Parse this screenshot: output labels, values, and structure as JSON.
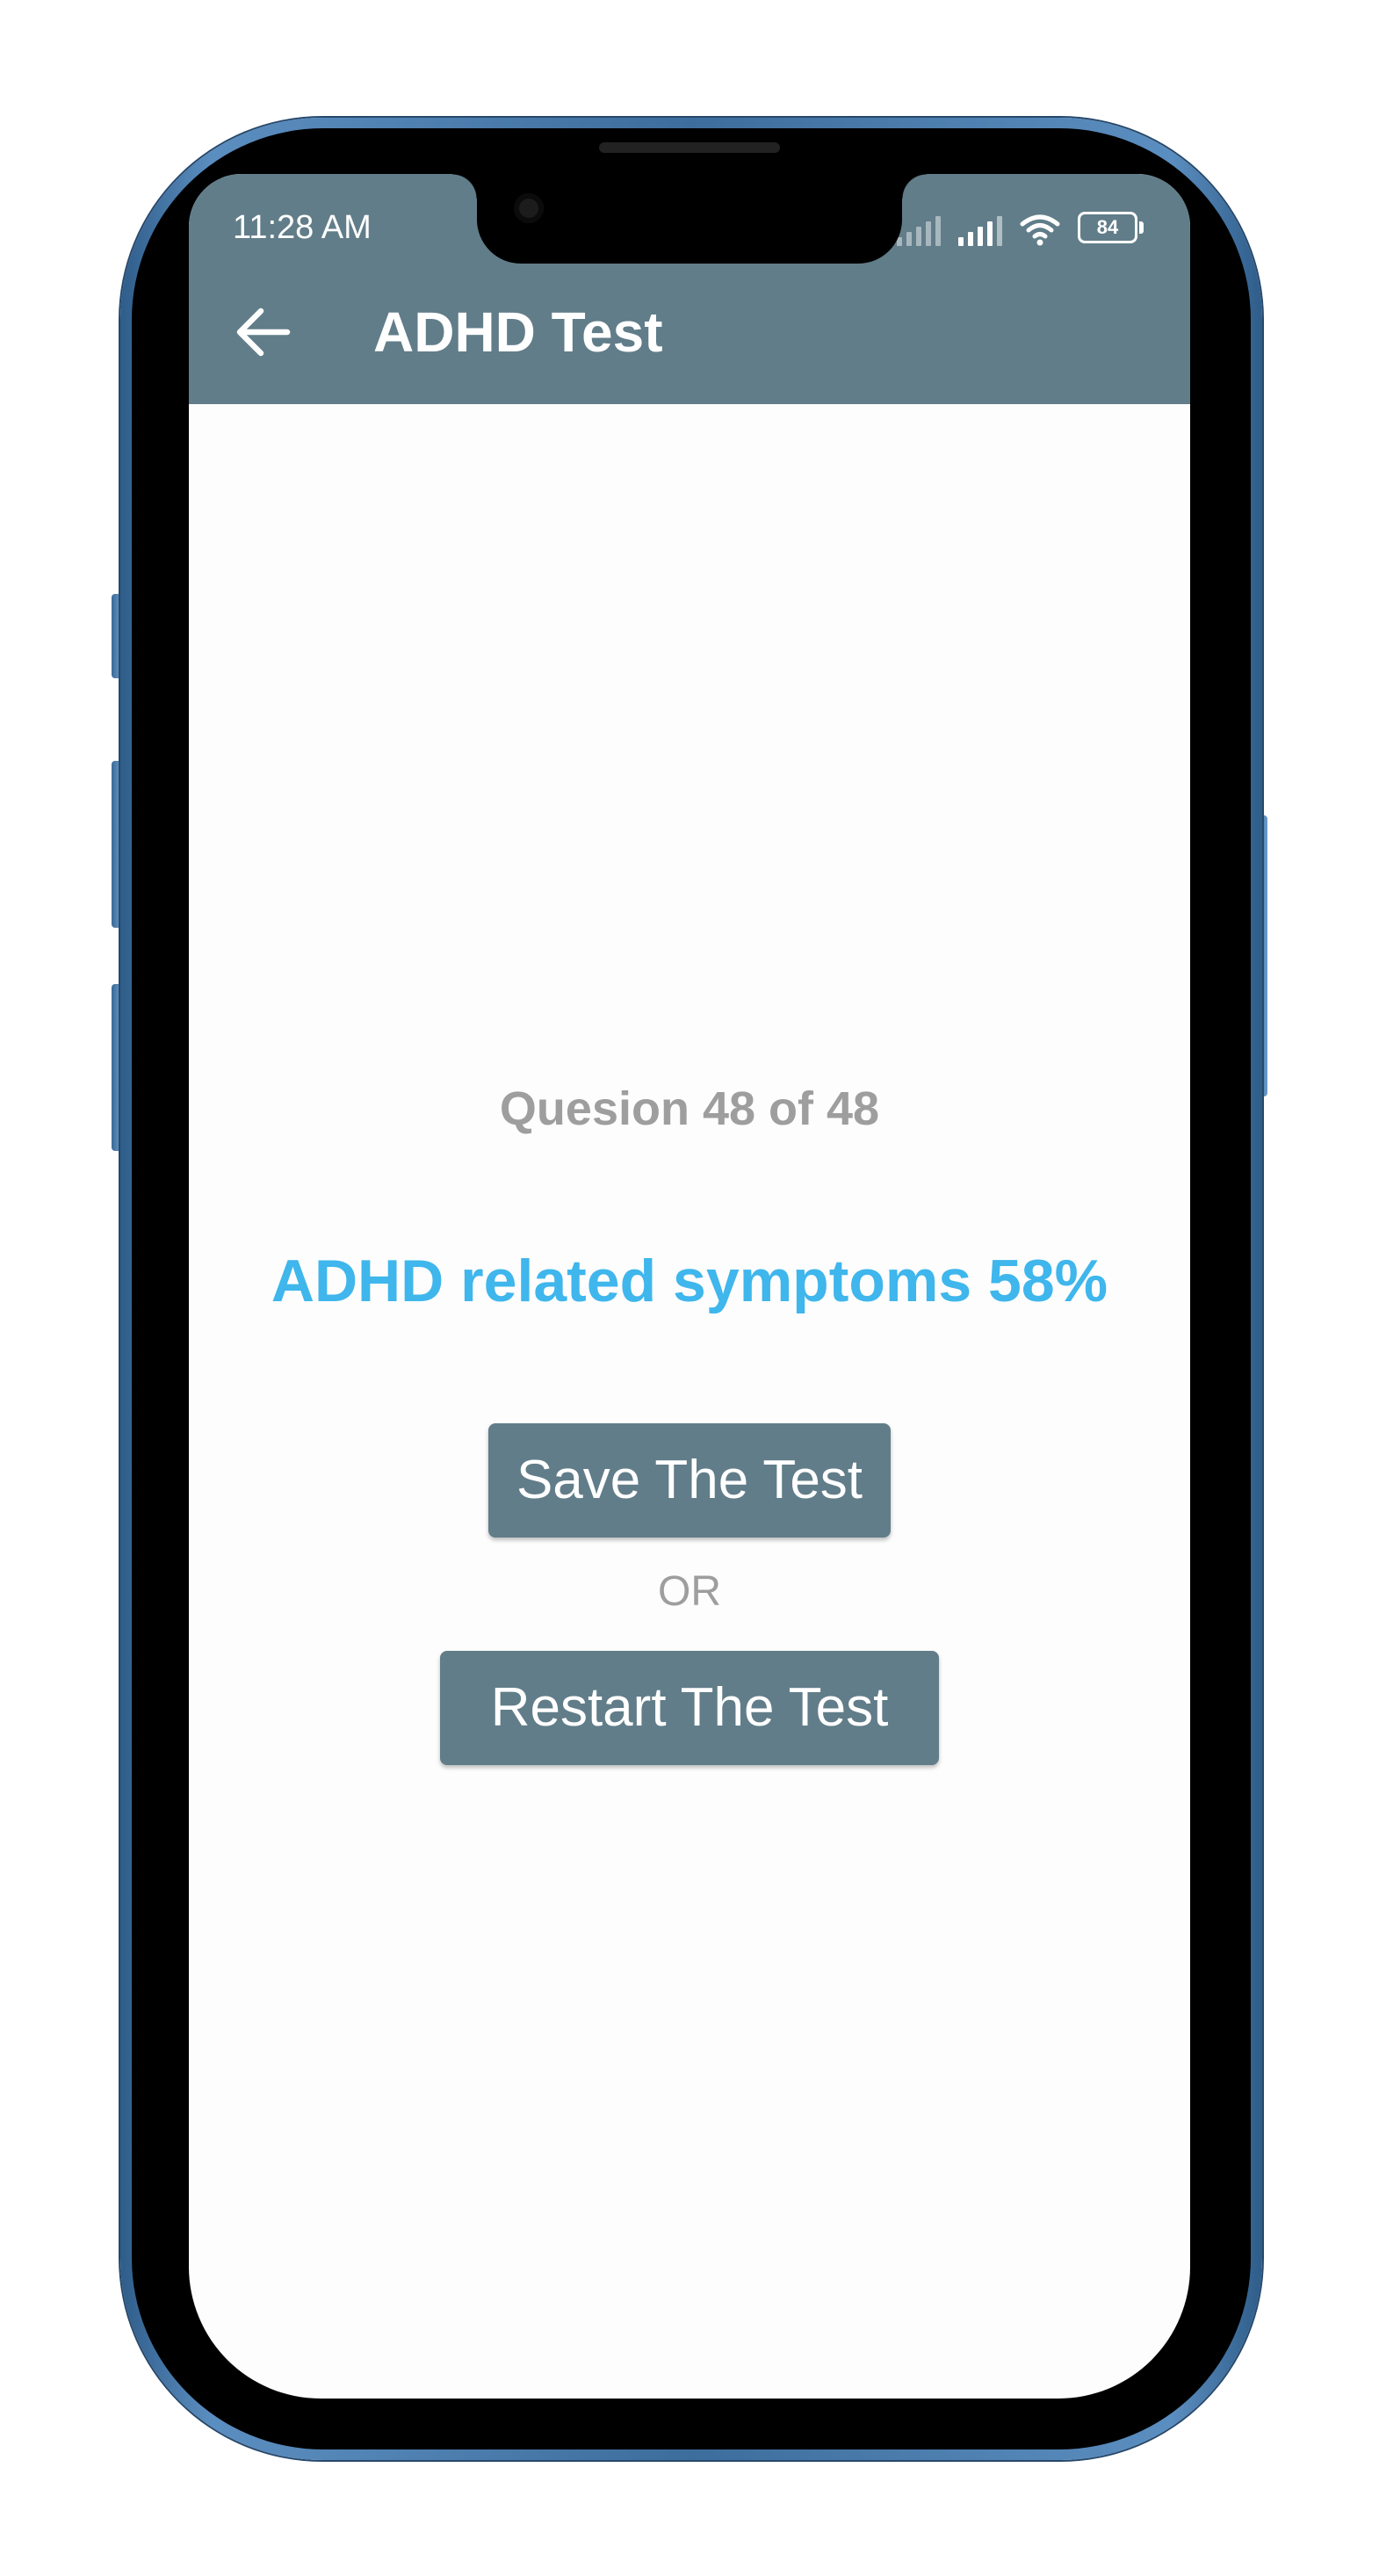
{
  "status_bar": {
    "time": "11:28 AM",
    "battery": "84",
    "icons": [
      "signal-weak-icon",
      "signal-icon",
      "wifi-icon",
      "battery-icon"
    ]
  },
  "app_bar": {
    "title": "ADHD Test",
    "back_icon": "arrow-left-icon"
  },
  "main": {
    "question_counter": "Quesion 48 of 48",
    "result": "ADHD related symptoms 58%",
    "save_button_label": "Save The Test",
    "separator": "OR",
    "restart_button_label": "Restart The Test"
  },
  "colors": {
    "app_bar": "#617d89",
    "result_text": "#3fb6ec",
    "muted_text": "#9e9e9e",
    "button": "#617d89"
  }
}
